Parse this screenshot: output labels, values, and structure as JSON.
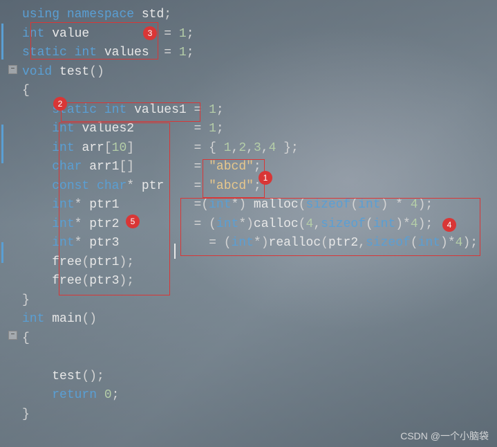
{
  "code": {
    "l1": {
      "kw1": "using",
      "kw2": "namespace",
      "ns": "std",
      "semi": ";"
    },
    "l2": {
      "type": "int",
      "name": "value",
      "eq": "= ",
      "val": "1",
      "semi": ";"
    },
    "l3": {
      "kw": "static",
      "type": "int",
      "name": "values",
      "eq": "= ",
      "val": "1",
      "semi": ";"
    },
    "l4": {
      "kw": "void",
      "name": "test",
      "parens": "()"
    },
    "l5": {
      "brace": "{"
    },
    "l6": {
      "pad": "    ",
      "kw": "static",
      "type": "int",
      "name": "values1",
      "eq": "= ",
      "val": "1",
      "semi": ";"
    },
    "l7": {
      "pad": "    ",
      "type": "int",
      "name": "values2",
      "eq": "= ",
      "val": "1",
      "semi": ";"
    },
    "l8": {
      "pad": "    ",
      "type": "int",
      "name": "arr",
      "dim": "[",
      "dsz": "10",
      "dim2": "]",
      "eq": "= { ",
      "v1": "1",
      "c": ",",
      "v2": "2",
      "v3": "3",
      "v4": "4",
      "end": " };"
    },
    "l9": {
      "pad": "    ",
      "type": "char",
      "name": "arr1",
      "dim": "[]",
      "eq": "= ",
      "str": "\"abcd\"",
      "semi": ";"
    },
    "l10": {
      "pad": "    ",
      "kw": "const",
      "type": "char",
      "ptr": "*",
      "name": "ptr",
      "eq": "= ",
      "str": "\"abcd\"",
      "semi": ";"
    },
    "l11": {
      "pad": "    ",
      "type": "int",
      "ptr": "*",
      "name": "ptr1",
      "eq": "=(",
      "cast": "int",
      "castp": "*) ",
      "fn": "malloc",
      "p1": "(",
      "sz": "sizeof",
      "p2": "(",
      "t": "int",
      "p3": ") * ",
      "n": "4",
      "p4": ");"
    },
    "l12": {
      "pad": "    ",
      "type": "int",
      "ptr": "*",
      "name": "ptr2",
      "eq": "= (",
      "cast": "int",
      "castp": "*)",
      "fn": "calloc",
      "p1": "(",
      "n1": "4",
      "c": ",",
      "sz": "sizeof",
      "p2": "(",
      "t": "int",
      "p3": ")*",
      "n2": "4",
      "p4": ");"
    },
    "l13": {
      "pad": "    ",
      "type": "int",
      "ptr": "*",
      "name": "ptr3",
      "eq": "= (",
      "cast": "int",
      "castp": "*)",
      "fn": "realloc",
      "p1": "(",
      "arg": "ptr2",
      "c": ",",
      "sz": "sizeof",
      "p2": "(",
      "t": "int",
      "p3": ")*",
      "n": "4",
      "p4": ");"
    },
    "l14": {
      "pad": "    ",
      "fn": "free",
      "p1": "(",
      "arg": "ptr1",
      "p2": ");"
    },
    "l15": {
      "pad": "    ",
      "fn": "free",
      "p1": "(",
      "arg": "ptr3",
      "p2": ");"
    },
    "l16": {
      "brace": "}"
    },
    "l17": {
      "type": "int",
      "name": "main",
      "parens": "()"
    },
    "l18": {
      "brace": "{"
    },
    "l19": {
      "pad": ""
    },
    "l20": {
      "pad": "    ",
      "fn": "test",
      "p": "();"
    },
    "l21": {
      "pad": "    ",
      "kw": "return",
      "sp": " ",
      "val": "0",
      "semi": ";"
    },
    "l22": {
      "brace": "}"
    }
  },
  "badges": {
    "n1": "1",
    "n2": "2",
    "n3": "3",
    "n4": "4",
    "n5": "5"
  },
  "fold": {
    "minus": "−"
  },
  "watermark": "CSDN @一个小脑袋"
}
